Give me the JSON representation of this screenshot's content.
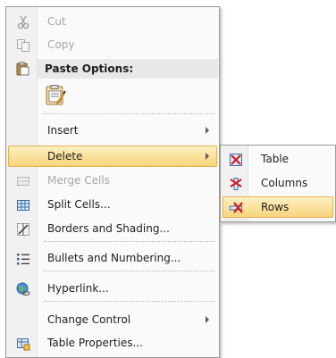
{
  "menu": {
    "cut": "Cut",
    "copy": "Copy",
    "paste_options": "Paste Options:",
    "insert": "Insert",
    "delete": "Delete",
    "merge_cells": "Merge Cells",
    "split_cells": "Split Cells...",
    "borders_shading": "Borders and Shading...",
    "bullets_numbering": "Bullets and Numbering...",
    "hyperlink": "Hyperlink...",
    "change_control": "Change Control",
    "table_properties": "Table Properties..."
  },
  "submenu": {
    "table": "Table",
    "columns": "Columns",
    "rows": "Rows"
  },
  "colors": {
    "highlight_top": "#fdf0c3",
    "highlight_bottom": "#f8d37b",
    "highlight_border": "#e7b14e",
    "disabled_text": "#a7a7a7"
  },
  "icons": {
    "cut": "scissors-icon",
    "copy": "copy-icon",
    "paste": "paste-clipboard-icon",
    "paste_keep_formatting": "paste-keep-formatting-icon",
    "merge_cells": "merge-cells-icon",
    "split_cells": "split-cells-icon",
    "borders": "borders-shading-icon",
    "bullets": "bullets-list-icon",
    "hyperlink": "hyperlink-globe-icon",
    "table_properties": "table-properties-icon",
    "delete_table": "delete-table-icon",
    "delete_columns": "delete-columns-icon",
    "delete_rows": "delete-rows-icon"
  }
}
